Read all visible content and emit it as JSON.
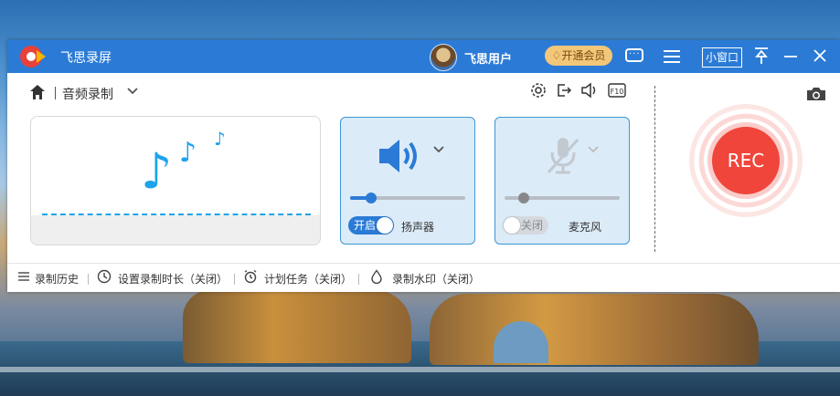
{
  "app": {
    "title": "飞思录屏"
  },
  "user": {
    "name": "飞思用户",
    "vip_label": "开通会员"
  },
  "titlebar": {
    "mini_window_label": "小窗口"
  },
  "toolbar": {
    "mode_label": "音频录制"
  },
  "speaker": {
    "toggle_label": "开启",
    "enabled": true,
    "device_label": "扬声器",
    "volume": 0.18
  },
  "mic": {
    "toggle_label": "关闭",
    "enabled": false,
    "device_label": "麦克风",
    "volume": 0.17
  },
  "record": {
    "label": "REC"
  },
  "statusbar": {
    "history": "录制历史",
    "duration": "设置录制时长（关闭）",
    "schedule": "计划任务（关闭）",
    "watermark": "录制水印（关闭）"
  },
  "colors": {
    "accent": "#2b7bd6",
    "rec": "#f0453b",
    "note": "#1ea4ea",
    "vip": "#f3c77a"
  }
}
